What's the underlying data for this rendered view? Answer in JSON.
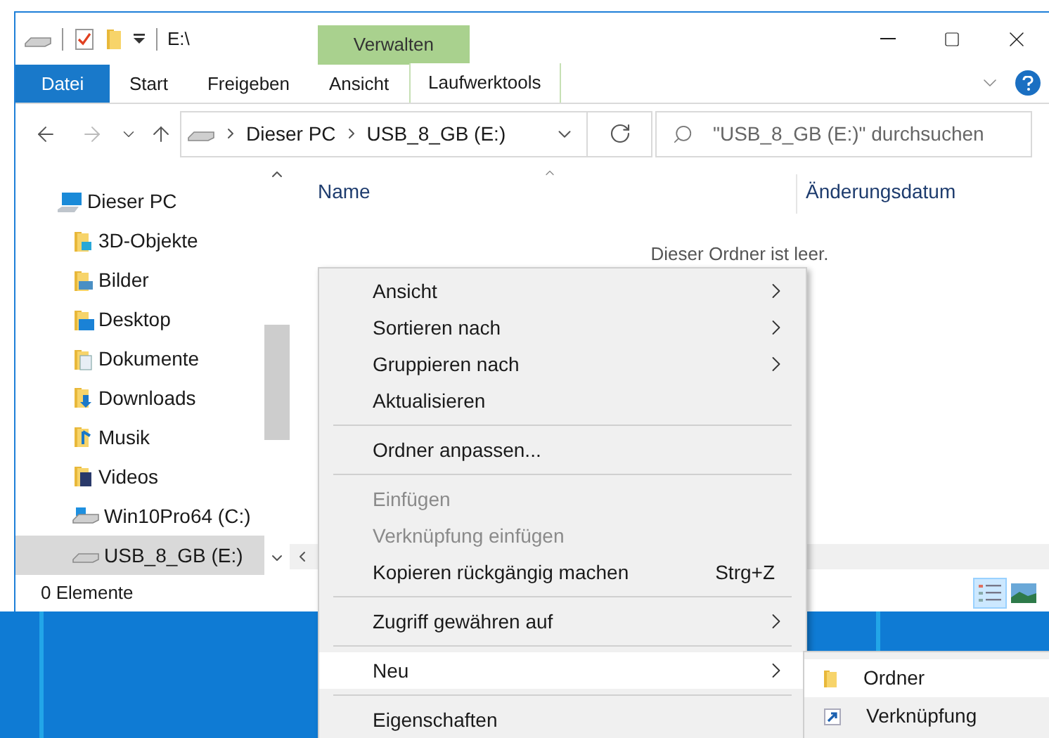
{
  "window": {
    "title": "E:\\"
  },
  "ribbon": {
    "context_group": "Verwalten",
    "tabs": [
      {
        "label": "Datei",
        "kind": "file",
        "selected": false
      },
      {
        "label": "Start",
        "kind": "normal",
        "selected": false
      },
      {
        "label": "Freigeben",
        "kind": "normal",
        "selected": false
      },
      {
        "label": "Ansicht",
        "kind": "normal",
        "selected": false
      },
      {
        "label": "Laufwerktools",
        "kind": "contextual",
        "selected": false
      }
    ]
  },
  "address_bar": {
    "path": [
      "Dieser PC",
      "USB_8_GB (E:)"
    ]
  },
  "search": {
    "placeholder": "\"USB_8_GB (E:)\" durchsuchen"
  },
  "navigation": {
    "items": [
      {
        "label": "Dieser PC",
        "kind": "pc",
        "selected": false,
        "children": [
          {
            "label": "3D-Objekte",
            "kind": "objects3d",
            "selected": false
          },
          {
            "label": "Bilder",
            "kind": "pictures",
            "selected": false
          },
          {
            "label": "Desktop",
            "kind": "desktop",
            "selected": false
          },
          {
            "label": "Dokumente",
            "kind": "documents",
            "selected": false
          },
          {
            "label": "Downloads",
            "kind": "downloads",
            "selected": false
          },
          {
            "label": "Musik",
            "kind": "music",
            "selected": false
          },
          {
            "label": "Videos",
            "kind": "videos",
            "selected": false
          },
          {
            "label": "Win10Pro64 (C:)",
            "kind": "system_drive",
            "selected": false
          },
          {
            "label": "USB_8_GB (E:)",
            "kind": "usb_drive",
            "selected": true
          }
        ]
      }
    ]
  },
  "file_list": {
    "columns": [
      "Name",
      "Änderungsdatum"
    ],
    "empty_message": "Dieser Ordner ist leer."
  },
  "status_bar": {
    "item_count": "0 Elemente",
    "views": [
      {
        "kind": "details",
        "selected": true
      },
      {
        "kind": "large_icons",
        "selected": false
      }
    ]
  },
  "context_menu": {
    "items": [
      {
        "kind": "item",
        "label": "Ansicht",
        "submenu": true,
        "disabled": false,
        "selected": false
      },
      {
        "kind": "item",
        "label": "Sortieren nach",
        "submenu": true,
        "disabled": false,
        "selected": false
      },
      {
        "kind": "item",
        "label": "Gruppieren nach",
        "submenu": true,
        "disabled": false,
        "selected": false
      },
      {
        "kind": "item",
        "label": "Aktualisieren",
        "submenu": false,
        "disabled": false,
        "selected": false
      },
      {
        "kind": "separator"
      },
      {
        "kind": "item",
        "label": "Ordner anpassen...",
        "submenu": false,
        "disabled": false,
        "selected": false
      },
      {
        "kind": "separator"
      },
      {
        "kind": "item",
        "label": "Einfügen",
        "submenu": false,
        "disabled": true,
        "selected": false
      },
      {
        "kind": "item",
        "label": "Verknüpfung einfügen",
        "submenu": false,
        "disabled": true,
        "selected": false
      },
      {
        "kind": "item",
        "label": "Kopieren rückgängig machen",
        "shortcut": "Strg+Z",
        "submenu": false,
        "disabled": false,
        "selected": false
      },
      {
        "kind": "separator"
      },
      {
        "kind": "item",
        "label": "Zugriff gewähren auf",
        "submenu": true,
        "disabled": false,
        "selected": false
      },
      {
        "kind": "separator"
      },
      {
        "kind": "item",
        "label": "Neu",
        "submenu": true,
        "disabled": false,
        "selected": true
      },
      {
        "kind": "separator"
      },
      {
        "kind": "item",
        "label": "Eigenschaften",
        "submenu": false,
        "disabled": false,
        "selected": false
      }
    ]
  },
  "submenu": {
    "items": [
      {
        "label": "Ordner",
        "kind": "folder",
        "selected": true
      },
      {
        "label": "Verknüpfung",
        "kind": "shortcut",
        "selected": false
      }
    ]
  }
}
